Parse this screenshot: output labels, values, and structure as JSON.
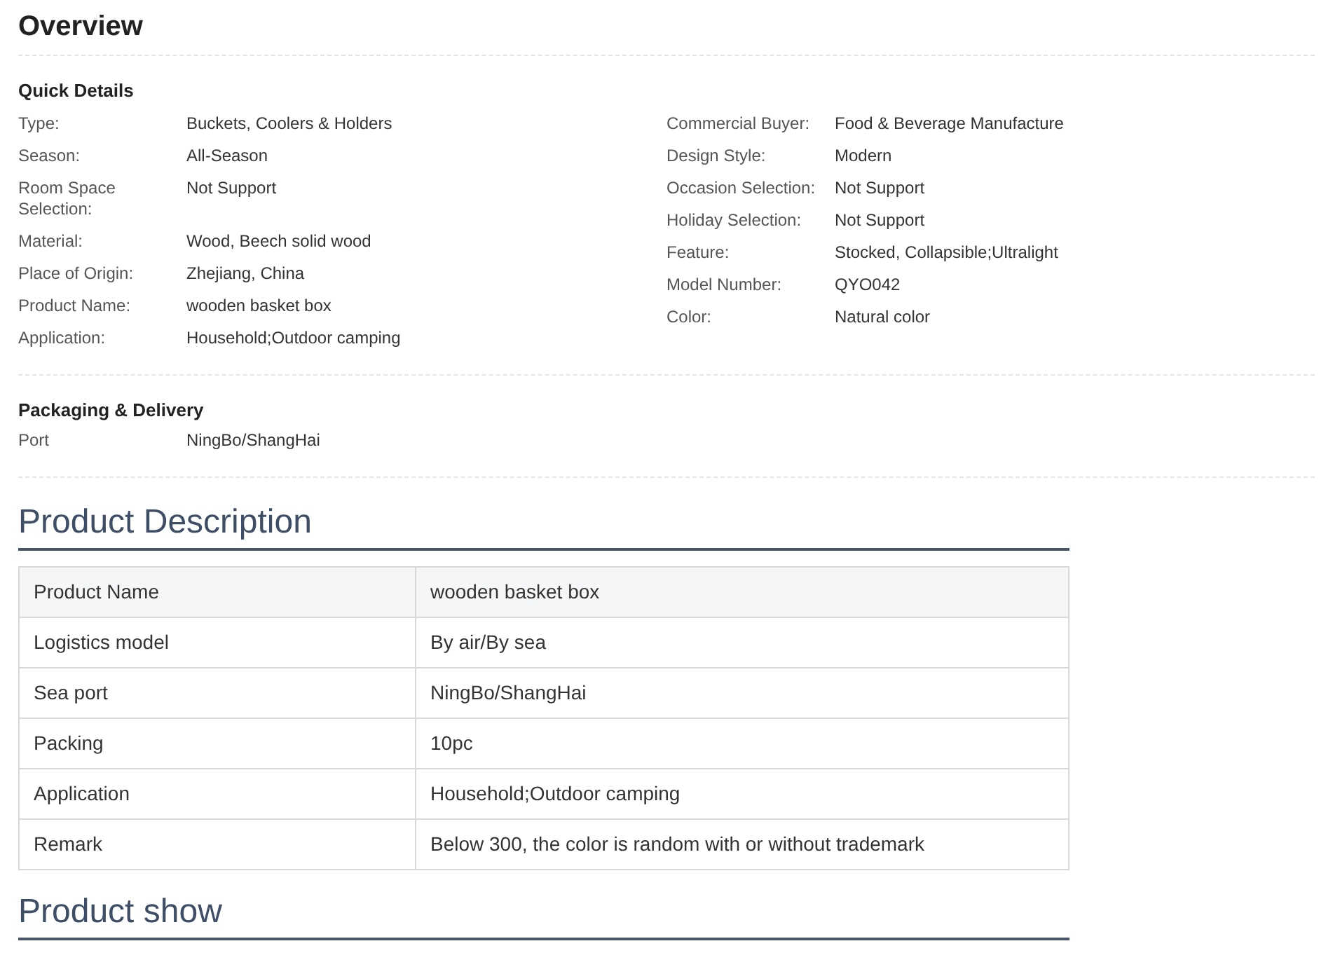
{
  "overview": {
    "title": "Overview",
    "quick_details": {
      "title": "Quick Details",
      "left": [
        {
          "label": "Type:",
          "value": "Buckets, Coolers & Holders"
        },
        {
          "label": "Season:",
          "value": "All-Season"
        },
        {
          "label": "Room Space Selection:",
          "value": "Not Support"
        },
        {
          "label": "Material:",
          "value": "Wood, Beech solid wood"
        },
        {
          "label": "Place of Origin:",
          "value": "Zhejiang, China"
        },
        {
          "label": "Product Name:",
          "value": "wooden basket box"
        },
        {
          "label": "Application:",
          "value": "Household;Outdoor camping"
        }
      ],
      "right": [
        {
          "label": "Commercial Buyer:",
          "value": "Food & Beverage Manufacture"
        },
        {
          "label": "Design Style:",
          "value": "Modern"
        },
        {
          "label": "Occasion Selection:",
          "value": "Not Support"
        },
        {
          "label": "Holiday Selection:",
          "value": "Not Support"
        },
        {
          "label": "Feature:",
          "value": "Stocked, Collapsible;Ultralight"
        },
        {
          "label": "Model Number:",
          "value": "QYO042"
        },
        {
          "label": "Color:",
          "value": "Natural color"
        }
      ]
    },
    "packaging": {
      "title": "Packaging & Delivery",
      "items": [
        {
          "label": "Port",
          "value": "NingBo/ShangHai"
        }
      ]
    }
  },
  "product_description": {
    "title": "Product Description",
    "rows": [
      [
        "Product Name",
        "wooden basket box"
      ],
      [
        "Logistics model",
        "By air/By sea"
      ],
      [
        "Sea port",
        "NingBo/ShangHai"
      ],
      [
        "Packing",
        "10pc"
      ],
      [
        "Application",
        "Household;Outdoor camping"
      ],
      [
        "Remark",
        "Below 300, the color is random with or without trademark"
      ]
    ]
  },
  "product_show": {
    "title": "Product show"
  }
}
